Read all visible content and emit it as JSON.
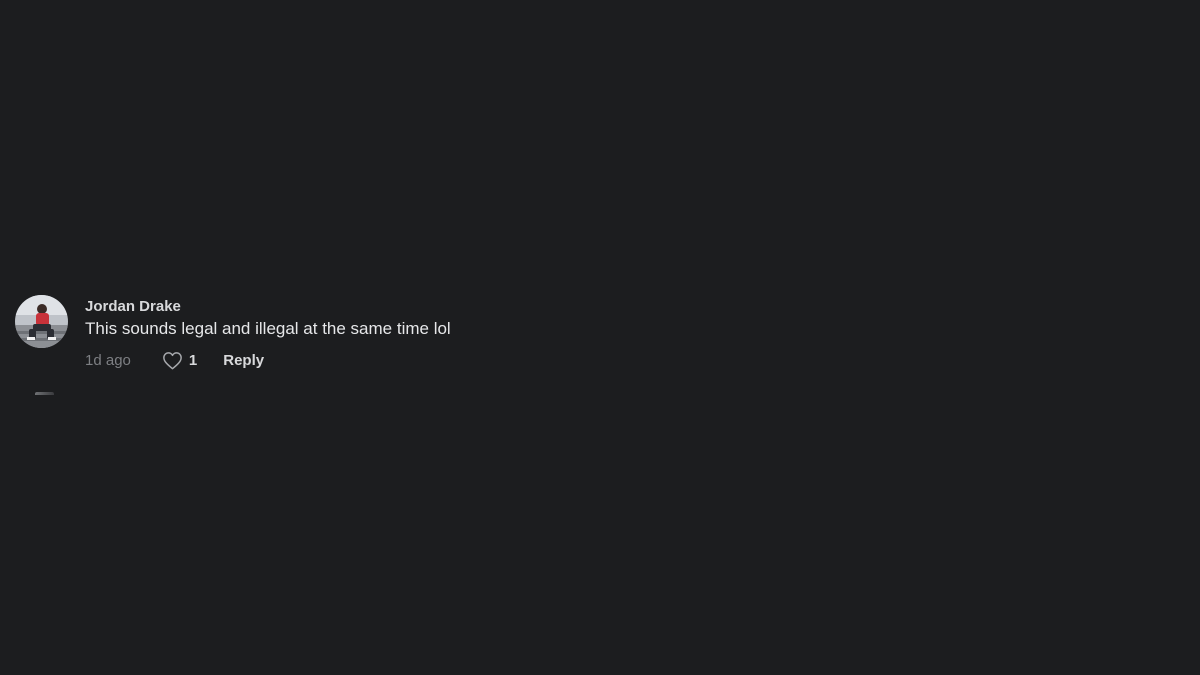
{
  "comment": {
    "avatar_icon": "user-avatar-photo",
    "author": "Jordan Drake",
    "text": "This sounds legal and illegal at the same time lol",
    "time": "1d ago",
    "like_icon": "heart-outline-icon",
    "like_count": "1",
    "reply_label": "Reply"
  },
  "colors": {
    "background": "#1c1d1f",
    "primary_text": "#e6e7e9",
    "secondary_text": "#7d7f83"
  }
}
